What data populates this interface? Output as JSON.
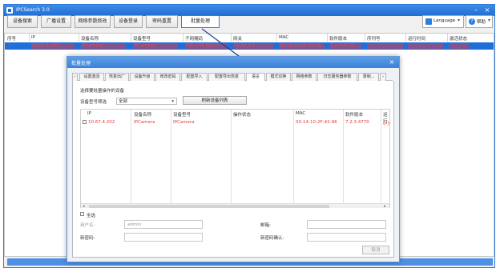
{
  "app": {
    "title": "IPCSearch 3.0"
  },
  "window_controls": {
    "minimize": "–",
    "close": "×"
  },
  "toolbar": {
    "buttons": [
      "设备搜索",
      "广播设置",
      "网络参数修改",
      "设备登录",
      "密码重置",
      "批量处理"
    ],
    "language_label": "Language",
    "help_label": "帮助"
  },
  "table": {
    "columns": [
      "序号",
      "IP",
      "设备名称",
      "设备型号",
      "子网掩码",
      "网关",
      "MAC",
      "软件版本",
      "序列号",
      "运行时间",
      "激活状态"
    ],
    "rows": [
      {
        "cells": [
          "1",
          "10.67.4.202",
          "IPCamera",
          "IPCamera",
          "255.255.255.0",
          "10.67.4.1",
          "00-14-10-2F-42-96",
          "7.2.3.4770",
          "",
          "",
          ""
        ]
      }
    ]
  },
  "dialog": {
    "title": "批量处理",
    "tabs": [
      "设置激活",
      "恢复出厂",
      "设备升级",
      "修改密码",
      "配置导入",
      "配置导出恢复",
      "语言",
      "模式切换",
      "网络参数",
      "日志服务器参数",
      "录制..."
    ],
    "selected_tab": "语言",
    "prompt": "选择要批量操作的设备",
    "filter_label": "设备型号筛选",
    "filter_value": "全部",
    "refresh_label": "刷新设备列表",
    "inner_columns": [
      "IP",
      "设备名称",
      "设备型号",
      "操作状态",
      "MAC",
      "软件版本",
      "运行"
    ],
    "inner_rows": [
      {
        "ip": "10.67.4.202",
        "name": "IPCamera",
        "model": "IPCamera",
        "status": "",
        "mac": "00-14-10-2F-42-96",
        "version": "7.2.3.4770",
        "run": "0小"
      }
    ],
    "select_all": "全选",
    "username_label": "用户名:",
    "username_value": "admin",
    "mailbox_label": "邮箱:",
    "new_password_label": "新密码:",
    "confirm_password_label": "新密码确认:",
    "cancel_label": "取消"
  },
  "colors": {
    "accent": "#1e6fd9",
    "row_text": "#ff4040",
    "title_bar": "#2b7de0"
  }
}
